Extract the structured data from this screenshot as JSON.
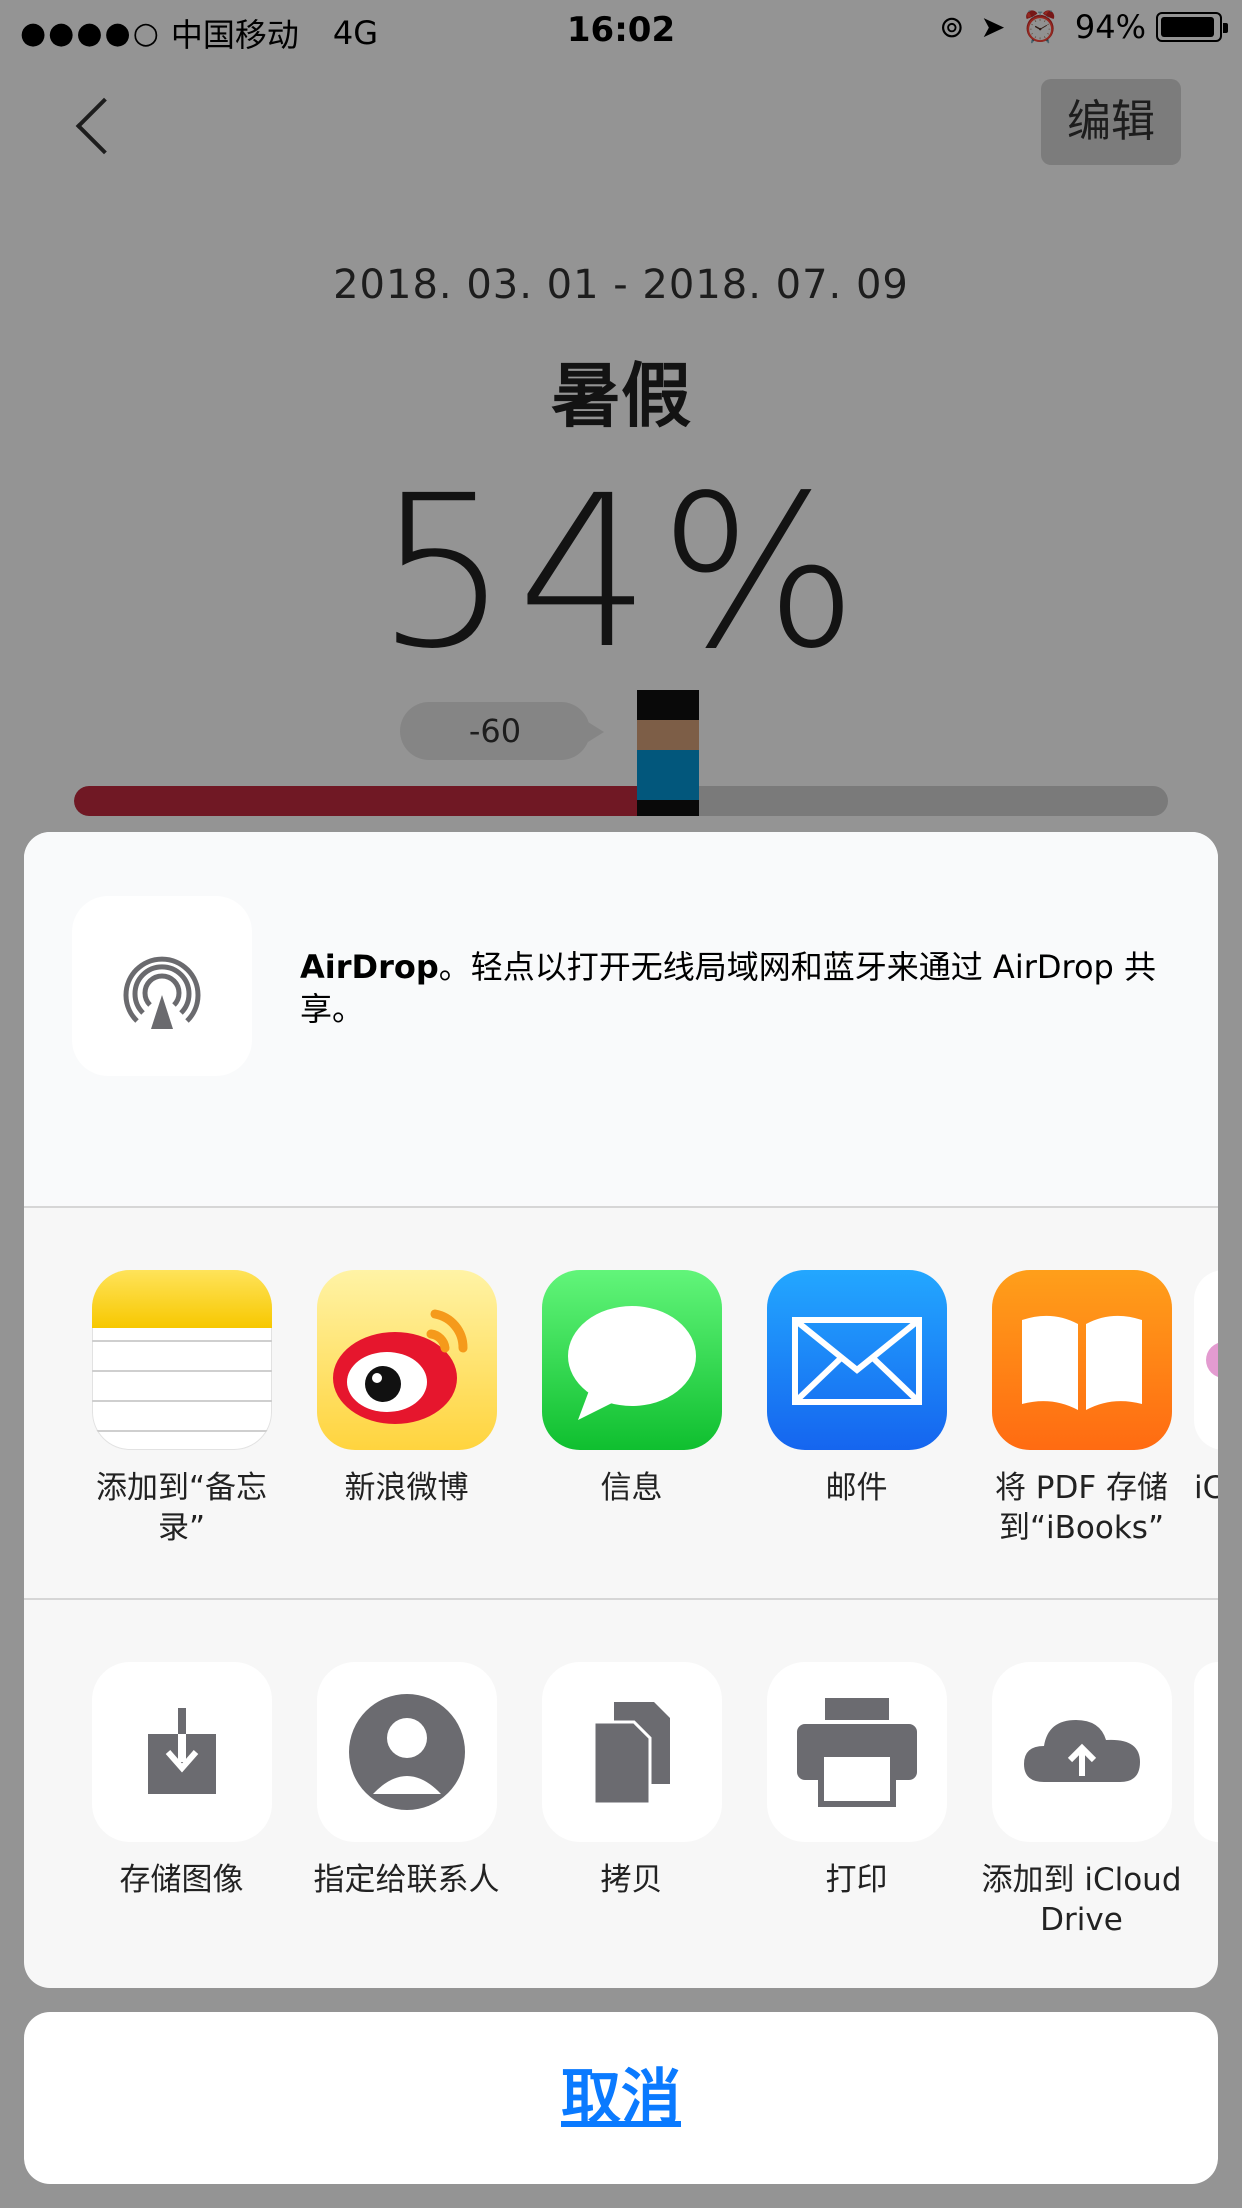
{
  "status_bar": {
    "signal": "●●●●○",
    "carrier": "中国移动",
    "network": "4G",
    "time": "16:02",
    "battery": "94%"
  },
  "nav": {
    "edit_label": "编辑"
  },
  "event": {
    "date_range": "2018. 03. 01 - 2018. 07. 09",
    "title": "暑假",
    "percent": "54%",
    "progress": 0.54,
    "bubble_value": "-60"
  },
  "share_sheet": {
    "airdrop_title": "AirDrop",
    "airdrop_text": "。轻点以打开无线局域网和蓝牙来通过 AirDrop 共享。",
    "apps": [
      {
        "label": "添加到“备忘录”",
        "icon": "notes-icon"
      },
      {
        "label": "新浪微博",
        "icon": "weibo-icon"
      },
      {
        "label": "信息",
        "icon": "messages-icon"
      },
      {
        "label": "邮件",
        "icon": "mail-icon"
      },
      {
        "label": "将 PDF 存储到“iBooks”",
        "icon": "ibooks-icon"
      },
      {
        "label": "iCl",
        "icon": "icloud-app-icon"
      }
    ],
    "actions": [
      {
        "label": "存储图像",
        "icon": "save-image-icon"
      },
      {
        "label": "指定给联系人",
        "icon": "contact-icon"
      },
      {
        "label": "拷贝",
        "icon": "copy-icon"
      },
      {
        "label": "打印",
        "icon": "print-icon"
      },
      {
        "label": "添加到 iCloud Drive",
        "icon": "icloud-upload-icon"
      }
    ],
    "cancel_label": "取消"
  },
  "colors": {
    "accent": "#0a7aff",
    "progress_fill": "#c12a3e",
    "progress_track": "#d2d2d2"
  }
}
